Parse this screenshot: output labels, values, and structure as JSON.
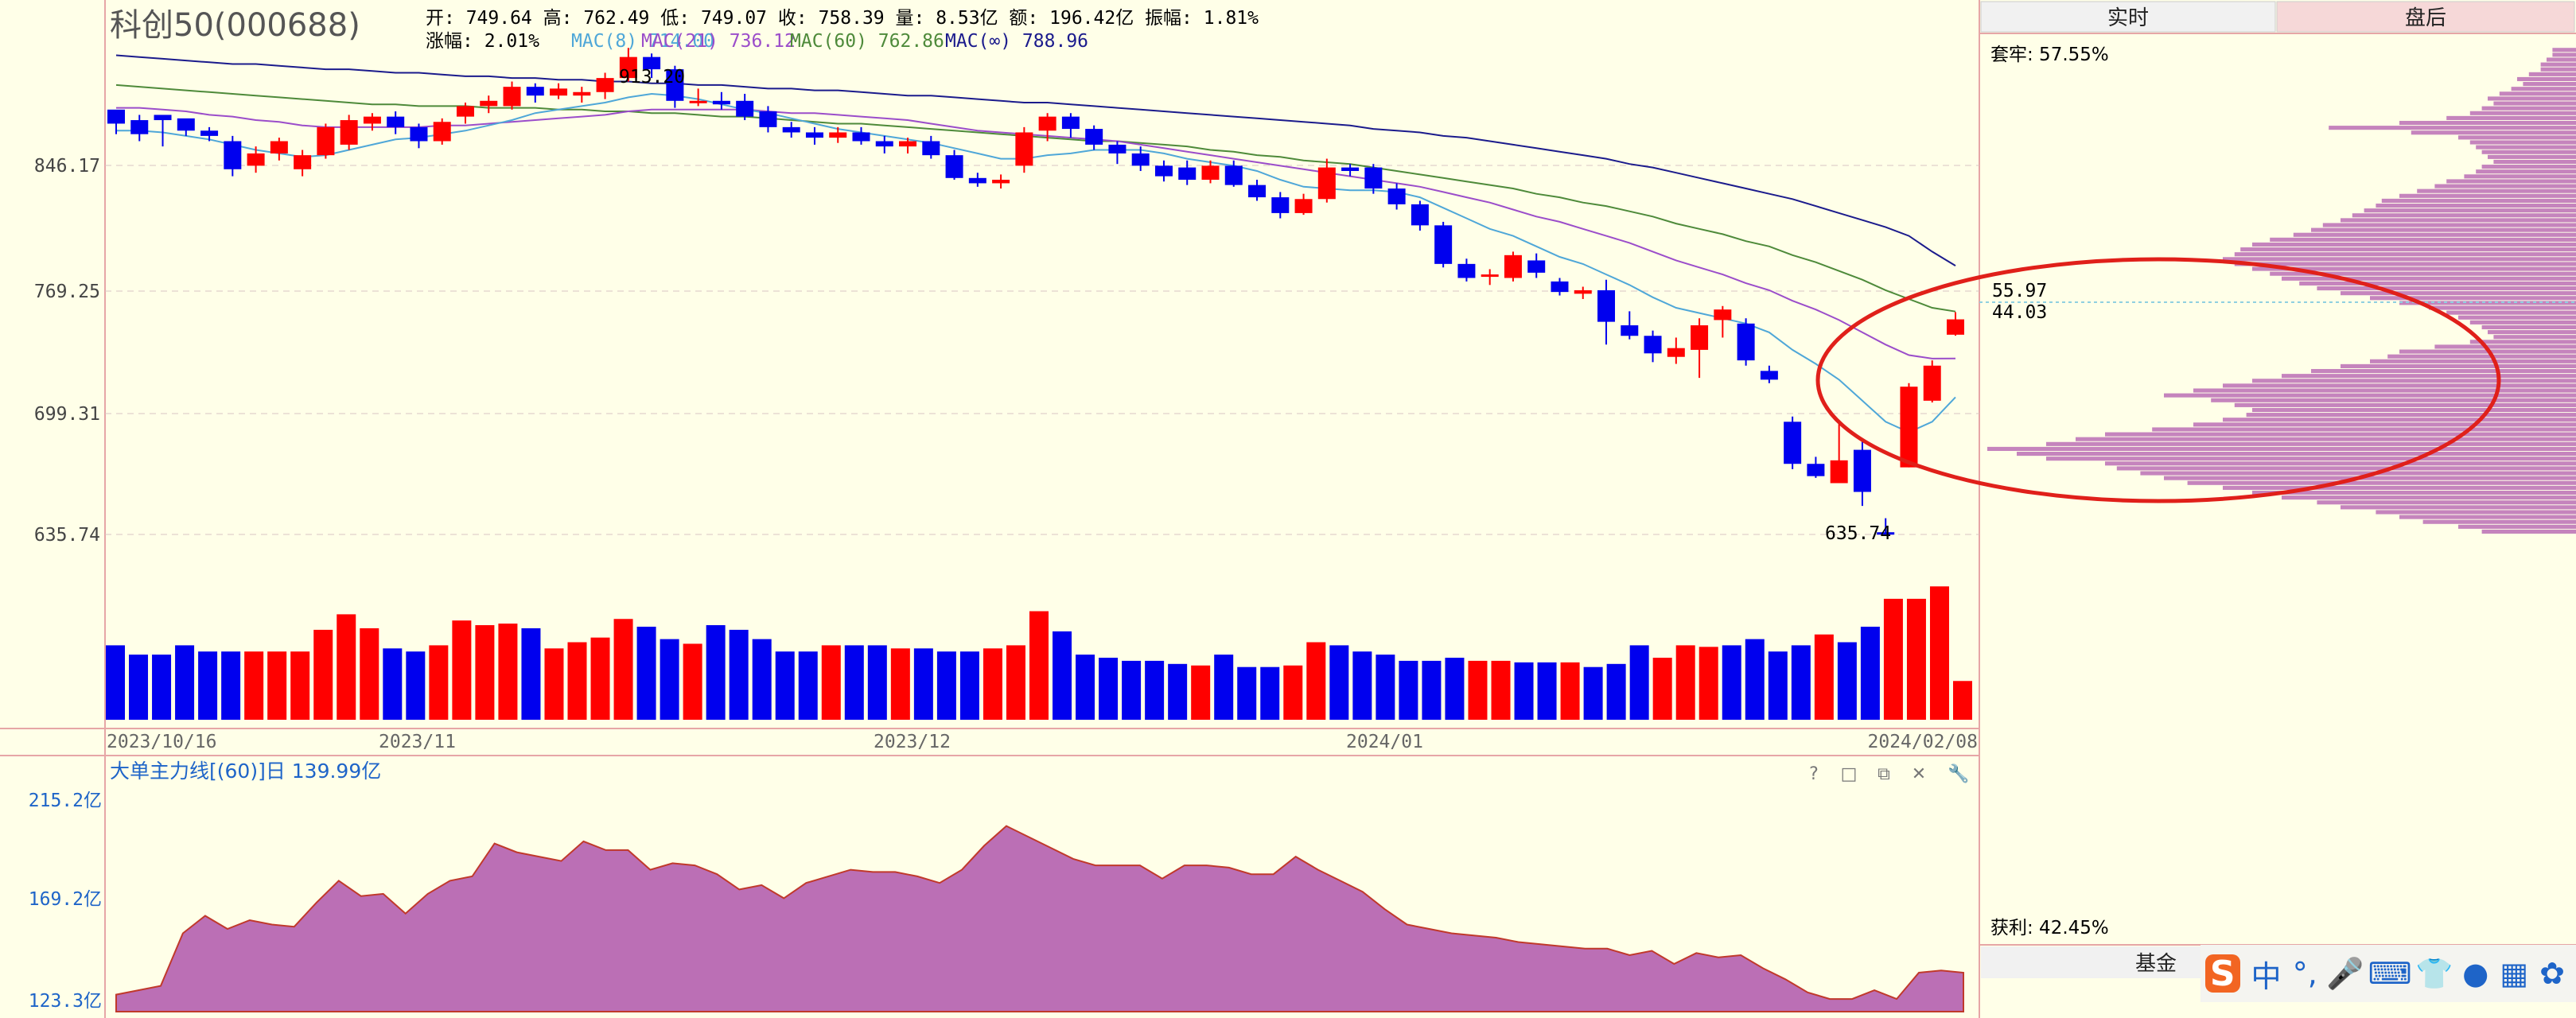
{
  "header": {
    "title": "科创50(000688)",
    "ohlc_line": "开: 749.64 高: 762.49 低: 749.07 收: 758.39 量: 8.53亿 额: 196.42亿 振幅: 1.81%",
    "change_label": "涨幅: 2.01%",
    "ma8_label": "MAC(8) 714.00",
    "ma21_label": "MAC(21) 736.12",
    "ma60_label": "MAC(60) 762.86",
    "ma_inf_label": "MAC(∞) 788.96"
  },
  "tabs": [
    "实时",
    "盘后"
  ],
  "right_panel": {
    "trapped_label": "套牢: 57.55%",
    "profit_label": "获利: 42.45%",
    "bottom_tab": "基金",
    "level_upper": "55.97",
    "level_lower": "44.03"
  },
  "price_axis": {
    "ticks": [
      "846.17",
      "769.25",
      "699.31",
      "635.74"
    ]
  },
  "annotations": {
    "high_label": "913.20",
    "low_label": "635.74"
  },
  "date_axis": {
    "labels": [
      "2023/10/16",
      "2023/11",
      "2023/12",
      "2024/01",
      "2024/02/08"
    ]
  },
  "lower_panel": {
    "title": "大单主力线[(60)]日 139.99亿",
    "ticks": [
      "215.2亿",
      "169.2亿",
      "123.3亿"
    ],
    "buttons": [
      "?",
      "□",
      "⧉",
      "✕",
      "🔧"
    ]
  },
  "ime_toolbar": {
    "logo": "S",
    "items": [
      "中",
      "°,",
      "🎤",
      "⌨",
      "👕",
      "●",
      "▦",
      "✿"
    ]
  },
  "colors": {
    "up": "#FF0000",
    "down": "#0000EE",
    "ma8": "#4FA7D8",
    "ma21": "#9B4DCA",
    "ma60": "#4E8A3A",
    "ma_inf": "#1B1B8C",
    "fill": "#BB6FB5",
    "circle": "#E0201A"
  },
  "chart_data": [
    {
      "type": "candlestick",
      "title": "科创50(000688)",
      "ylim": [
        620,
        935
      ],
      "candles": [
        [
          878,
          870,
          872,
          864
        ],
        [
          872,
          864,
          875,
          860
        ],
        [
          875,
          872,
          874,
          857
        ],
        [
          873,
          866,
          870,
          863
        ],
        [
          866,
          863,
          868,
          860
        ],
        [
          860,
          844,
          863,
          840
        ],
        [
          846,
          853,
          857,
          842
        ],
        [
          853,
          860,
          862,
          849
        ],
        [
          844,
          852,
          855,
          840
        ],
        [
          852,
          868,
          870,
          850
        ],
        [
          858,
          872,
          875,
          855
        ],
        [
          870,
          874,
          876,
          866
        ],
        [
          874,
          868,
          877,
          864
        ],
        [
          868,
          860,
          870,
          856
        ],
        [
          860,
          871,
          873,
          858
        ],
        [
          874,
          880,
          882,
          870
        ],
        [
          880,
          883,
          886,
          876
        ],
        [
          880,
          891,
          894,
          878
        ],
        [
          891,
          886,
          893,
          882
        ],
        [
          886,
          890,
          893,
          884
        ],
        [
          886,
          888,
          891,
          882
        ],
        [
          888,
          896,
          899,
          884
        ],
        [
          896,
          908,
          913.2,
          894
        ],
        [
          908,
          901,
          910,
          896
        ],
        [
          901,
          883,
          903,
          879
        ],
        [
          883,
          883,
          890,
          880
        ],
        [
          883,
          881,
          888,
          878
        ],
        [
          883,
          874,
          887,
          872
        ],
        [
          877,
          868,
          880,
          865
        ],
        [
          868,
          865,
          871,
          862
        ],
        [
          865,
          862,
          868,
          858
        ],
        [
          862,
          865,
          868,
          859
        ],
        [
          865,
          860,
          868,
          858
        ],
        [
          860,
          857,
          863,
          853
        ],
        [
          857,
          860,
          862,
          853
        ],
        [
          860,
          852,
          863,
          850
        ],
        [
          852,
          839,
          855,
          838
        ],
        [
          839,
          836,
          842,
          834
        ],
        [
          836,
          838,
          841,
          833
        ],
        [
          846,
          865,
          868,
          842
        ],
        [
          866,
          874,
          876,
          860
        ],
        [
          874,
          867,
          876,
          862
        ],
        [
          867,
          858,
          869,
          855
        ],
        [
          858,
          853,
          860,
          847
        ],
        [
          853,
          846,
          857,
          843
        ],
        [
          846,
          840,
          849,
          837
        ],
        [
          845,
          838,
          849,
          835
        ],
        [
          838,
          846,
          849,
          836
        ],
        [
          846,
          835,
          849,
          834
        ],
        [
          835,
          828,
          838,
          826
        ],
        [
          828,
          819,
          831,
          816
        ],
        [
          819,
          827,
          830,
          818
        ],
        [
          827,
          845,
          850,
          825
        ],
        [
          845,
          843,
          847,
          840
        ],
        [
          845,
          833,
          847,
          830
        ],
        [
          833,
          824,
          836,
          821
        ],
        [
          824,
          812,
          826,
          809
        ],
        [
          812,
          790,
          814,
          788
        ],
        [
          790,
          782,
          793,
          780
        ],
        [
          783,
          784,
          787,
          778
        ],
        [
          782,
          795,
          797,
          780
        ],
        [
          792,
          785,
          796,
          782
        ],
        [
          780,
          774,
          782,
          772
        ],
        [
          773,
          775,
          777,
          770
        ],
        [
          775,
          757,
          781,
          744
        ],
        [
          755,
          749,
          763,
          747
        ],
        [
          749,
          739,
          752,
          734
        ],
        [
          737,
          742,
          748,
          733
        ],
        [
          741,
          755,
          759,
          725
        ],
        [
          758,
          764,
          766,
          748
        ],
        [
          756,
          735,
          759,
          732
        ],
        [
          729,
          724,
          732,
          722
        ],
        [
          700,
          676,
          703,
          673
        ],
        [
          676,
          669,
          680,
          668
        ],
        [
          665,
          678,
          700,
          667
        ],
        [
          684,
          660,
          689,
          652
        ],
        [
          637,
          636.5,
          645,
          635.74
        ],
        [
          674,
          720,
          722,
          674
        ],
        [
          712,
          732,
          735,
          711
        ],
        [
          749.64,
          758.39,
          762.49,
          749.07
        ]
      ],
      "ma8": [
        866,
        866,
        865,
        863,
        861,
        858,
        855,
        853,
        851,
        852,
        855,
        858,
        861,
        862,
        864,
        866,
        869,
        872,
        876,
        878,
        880,
        882,
        885,
        887,
        886,
        884,
        881,
        878,
        876,
        873,
        870,
        867,
        865,
        863,
        861,
        859,
        856,
        853,
        850,
        850,
        852,
        853,
        855,
        855,
        855,
        853,
        850,
        848,
        846,
        843,
        838,
        834,
        833,
        832,
        832,
        831,
        828,
        822,
        816,
        810,
        806,
        800,
        794,
        790,
        784,
        778,
        771,
        765,
        762,
        759,
        756,
        751,
        741,
        733,
        724,
        712,
        700,
        694,
        700,
        714
      ],
      "ma21": [
        879,
        879,
        878,
        877,
        875,
        874,
        872,
        871,
        869,
        868,
        868,
        868,
        868,
        868,
        869,
        869,
        870,
        871,
        872,
        873,
        874,
        875,
        877,
        878,
        878,
        878,
        878,
        878,
        877,
        876,
        876,
        875,
        874,
        873,
        872,
        870,
        868,
        866,
        865,
        864,
        863,
        862,
        861,
        860,
        858,
        856,
        854,
        852,
        850,
        848,
        846,
        844,
        842,
        840,
        838,
        836,
        834,
        831,
        828,
        825,
        821,
        817,
        814,
        810,
        806,
        802,
        797,
        792,
        788,
        784,
        779,
        775,
        769,
        764,
        758,
        751,
        744,
        738,
        736,
        736.12
      ],
      "ma60": [
        892,
        891,
        890,
        889,
        888,
        887,
        886,
        885,
        884,
        883,
        882,
        881,
        881,
        880,
        880,
        880,
        879,
        879,
        879,
        878,
        878,
        877,
        877,
        876,
        876,
        875,
        874,
        874,
        873,
        872,
        871,
        870,
        870,
        869,
        868,
        867,
        866,
        865,
        864,
        863,
        862,
        861,
        860,
        860,
        859,
        858,
        857,
        855,
        854,
        852,
        851,
        849,
        848,
        847,
        845,
        843,
        841,
        839,
        837,
        835,
        833,
        830,
        828,
        825,
        823,
        820,
        817,
        813,
        810,
        807,
        803,
        800,
        795,
        791,
        786,
        781,
        775,
        770,
        765,
        762.86
      ],
      "ma_inf": [
        909,
        908,
        907,
        906,
        905,
        904,
        904,
        903,
        902,
        901,
        901,
        900,
        899,
        899,
        898,
        897,
        897,
        896,
        896,
        895,
        895,
        894,
        894,
        893,
        893,
        892,
        892,
        891,
        890,
        890,
        889,
        889,
        888,
        887,
        886,
        886,
        885,
        884,
        883,
        882,
        882,
        881,
        880,
        879,
        878,
        877,
        876,
        875,
        874,
        873,
        872,
        871,
        870,
        869,
        867,
        866,
        865,
        863,
        862,
        860,
        858,
        856,
        854,
        852,
        850,
        847,
        845,
        842,
        839,
        836,
        833,
        830,
        827,
        823,
        819,
        815,
        811,
        806,
        797,
        788.96
      ]
    },
    {
      "type": "bar",
      "title": "volume",
      "values": [
        48,
        42,
        42,
        48,
        44,
        44,
        44,
        44,
        44,
        58,
        68,
        59,
        46,
        44,
        48,
        64,
        61,
        62,
        59,
        46,
        50,
        53,
        65,
        60,
        52,
        49,
        61,
        58,
        52,
        44,
        44,
        48,
        48,
        48,
        46,
        46,
        44,
        44,
        46,
        48,
        70,
        57,
        42,
        40,
        38,
        38,
        36,
        35,
        42,
        34,
        34,
        35,
        50,
        48,
        44,
        42,
        38,
        38,
        40,
        38,
        38,
        37,
        37,
        37,
        34,
        36,
        48,
        40,
        48,
        47,
        48,
        52,
        44,
        48,
        55,
        50,
        60,
        78,
        78,
        86,
        25
      ]
    },
    {
      "type": "area",
      "title": "大单主力线[(60)]日 139.99亿",
      "ylim": [
        123.3,
        215.2
      ],
      "values": [
        126,
        128,
        130,
        154,
        162,
        156,
        160,
        158,
        157,
        168,
        178,
        171,
        172,
        163,
        172,
        178,
        180,
        195,
        191,
        189,
        187,
        196,
        192,
        192,
        183,
        186,
        185,
        181,
        174,
        176,
        170,
        177,
        180,
        183,
        182,
        182,
        180,
        177,
        183,
        194,
        203,
        198,
        193,
        188,
        185,
        185,
        185,
        179,
        185,
        185,
        184,
        181,
        181,
        189,
        183,
        178,
        173,
        165,
        158,
        156,
        154,
        153,
        152,
        150,
        149,
        148,
        147,
        147,
        144,
        146,
        140,
        145,
        143,
        144,
        138,
        133,
        127,
        124,
        124,
        128,
        124,
        136,
        137,
        136
      ]
    },
    {
      "type": "bar",
      "title": "筹码分布",
      "orientation": "horizontal",
      "y_range": [
        635.74,
        913.2
      ],
      "values": [
        4,
        4,
        5,
        6,
        6,
        8,
        10,
        9,
        11,
        13,
        15,
        14,
        16,
        18,
        22,
        30,
        42,
        28,
        20,
        18,
        17,
        16,
        15,
        14,
        16,
        17,
        19,
        22,
        24,
        27,
        30,
        33,
        34,
        36,
        38,
        40,
        43,
        45,
        48,
        52,
        55,
        57,
        58,
        60,
        58,
        55,
        52,
        50,
        47,
        44,
        40,
        35,
        30,
        25,
        22,
        20,
        18,
        16,
        15,
        14,
        18,
        24,
        30,
        32,
        35,
        40,
        45,
        50,
        55,
        60,
        65,
        70,
        62,
        58,
        55,
        56,
        60,
        65,
        72,
        80,
        85,
        90,
        100,
        95,
        90,
        80,
        78,
        74,
        70,
        66,
        60,
        55,
        50,
        44,
        40,
        34,
        30,
        26,
        20,
        16
      ]
    }
  ]
}
